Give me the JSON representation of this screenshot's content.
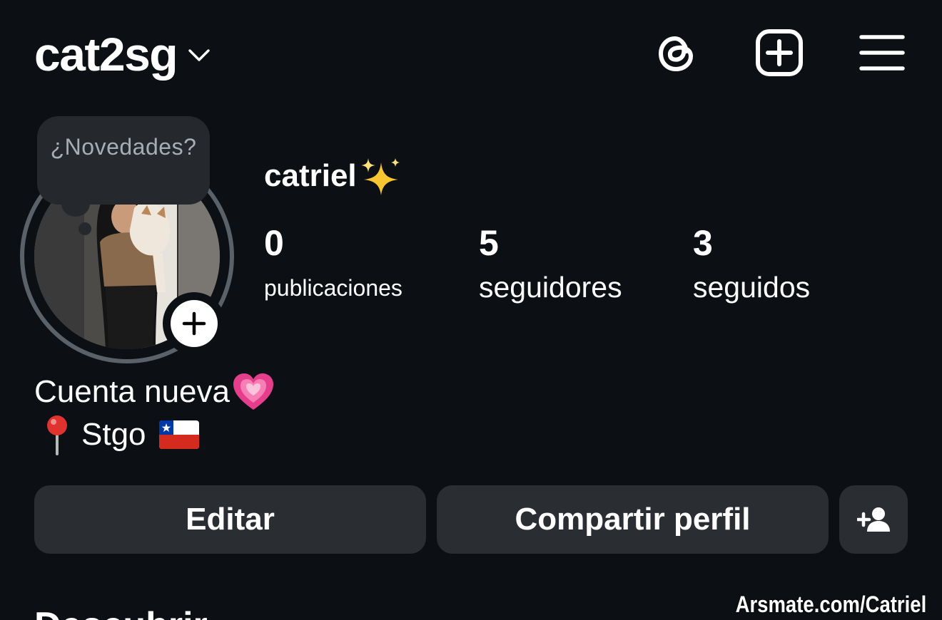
{
  "header": {
    "username": "cat2sg",
    "icons": [
      "chevron-down-icon",
      "threads-icon",
      "create-post-icon",
      "menu-icon"
    ]
  },
  "note": {
    "placeholder": "¿Novedades?"
  },
  "profile": {
    "display_name": "catriel",
    "name_emoji": "sparkles-icon",
    "stats": {
      "posts": {
        "count": "0",
        "label": "publicaciones"
      },
      "followers": {
        "count": "5",
        "label": "seguidores"
      },
      "following": {
        "count": "3",
        "label": "seguidos"
      }
    },
    "bio": {
      "line1": "Cuenta nueva",
      "line2": "Stgo",
      "icons": [
        "growing-heart-icon",
        "pushpin-icon",
        "chile-flag-icon"
      ]
    }
  },
  "actions": {
    "edit_label": "Editar",
    "share_label": "Compartir perfil",
    "add_person_icon": "add-person-icon"
  },
  "footer": {
    "cut_heading": "Descubrir",
    "watermark": "Arsmate.com/Catriel"
  },
  "colors": {
    "background": "#0c1014",
    "button": "#2a2e33",
    "note_bubble": "#25292e",
    "avatar_ring": "#5b6168",
    "text": "#ffffff",
    "muted_text": "#a8adb3"
  }
}
